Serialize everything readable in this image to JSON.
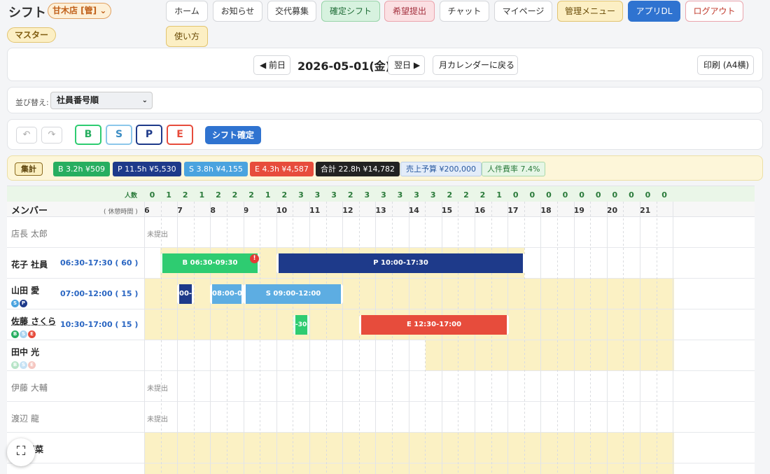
{
  "app": {
    "title": "シフト",
    "store": "甘木店 [管] ⌄",
    "master": "マスター"
  },
  "nav": {
    "home": "ホーム",
    "news": "お知らせ",
    "swap": "交代募集",
    "confirmed": "確定シフト",
    "request": "希望提出",
    "chat": "チャット",
    "mypage": "マイページ",
    "admin": "管理メニュー",
    "app_dl": "アプリDL",
    "logout": "ログアウト",
    "howto": "使い方"
  },
  "date_bar": {
    "prev": "◀ 前日",
    "date": "2026-05-01(金)",
    "next": "翌日 ▶",
    "month": "月カレンダーに戻る",
    "print": "印刷 (A4横)"
  },
  "sort": {
    "label": "並び替え:",
    "value": "社員番号順"
  },
  "toolbar": {
    "undo": "↶",
    "redo": "↷",
    "b": "B",
    "s": "S",
    "p": "P",
    "e": "E",
    "confirm": "シフト確定"
  },
  "summary": {
    "label": "集計",
    "b": "B 3.2h ¥509",
    "p": "P 11.5h ¥5,530",
    "s": "S 3.8h ¥4,155",
    "e": "E 4.3h ¥4,587",
    "total": "合計 22.8h ¥14,782",
    "budget": "売上予算 ¥200,000",
    "ratio": "人件費率 7.4%"
  },
  "grid": {
    "member_header": "メンバー",
    "break_header": "( 休憩時間 )",
    "count_header": "人数",
    "counts": [
      "0",
      "1",
      "2",
      "1",
      "2",
      "2",
      "2",
      "1",
      "2",
      "3",
      "3",
      "3",
      "2",
      "3",
      "3",
      "3",
      "3",
      "3",
      "2",
      "2",
      "2",
      "1",
      "0",
      "0",
      "0",
      "0",
      "0",
      "0",
      "0",
      "0",
      "0",
      "0"
    ],
    "hours": [
      "6",
      "7",
      "8",
      "9",
      "10",
      "11",
      "12",
      "13",
      "14",
      "15",
      "16",
      "17",
      "18",
      "19",
      "20",
      "21"
    ],
    "not_submitted": "未提出",
    "members": [
      {
        "name": "店長 太郎",
        "time": ""
      },
      {
        "name": "花子 社員",
        "time": "06:30-17:30 ( 60 )"
      },
      {
        "name": "山田 愛",
        "time": "07:00-12:00 ( 15 )"
      },
      {
        "name": "佐藤 さくら",
        "time": "10:30-17:00 ( 15 )"
      },
      {
        "name": "田中 光",
        "time": ""
      },
      {
        "name": "伊藤 大輔",
        "time": ""
      },
      {
        "name": "渡辺 龍",
        "time": ""
      },
      {
        "name": "陽菜",
        "time": ""
      }
    ],
    "bars": {
      "hanako_b": "B 06:30-09:30",
      "hanako_p": "P 10:00-17:30",
      "yamada_p": "00-0",
      "yamada_s1": "08:00-09:",
      "yamada_s2": "S 09:00-12:00",
      "sato_b": "-30-",
      "sato_e": "E 12:30-17:00"
    },
    "badges": {
      "s": "S",
      "p": "P",
      "b": "B",
      "e": "E"
    },
    "alert": "!"
  },
  "fullscreen": "⛶"
}
